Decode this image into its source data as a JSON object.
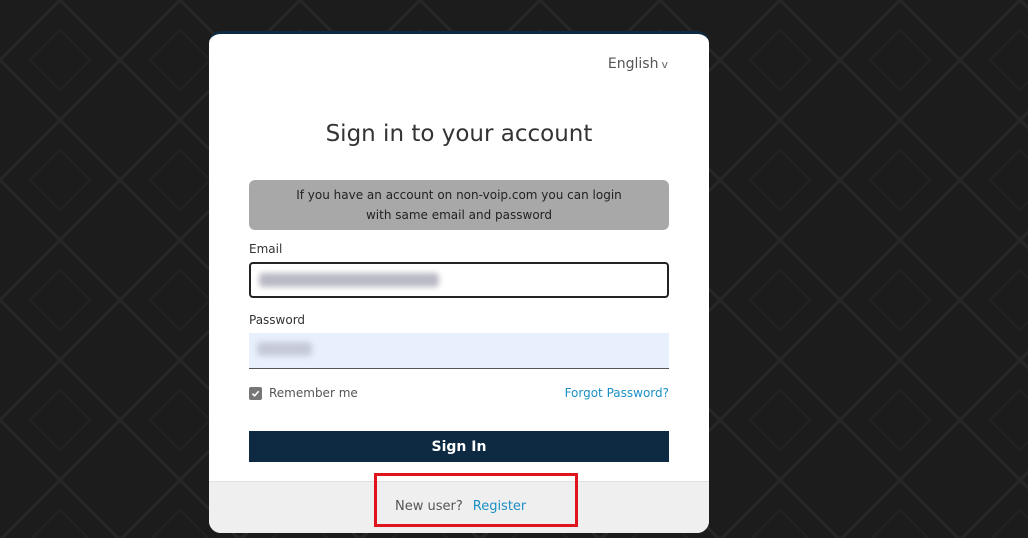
{
  "language": {
    "label": "English",
    "chevron": "v"
  },
  "title": "Sign in to your account",
  "notice": {
    "line1": "If you have an account on non-voip.com you can login",
    "line2": "with same email and password"
  },
  "email": {
    "label": "Email"
  },
  "password": {
    "label": "Password"
  },
  "remember": {
    "label": "Remember me",
    "checked": true
  },
  "forgot_label": "Forgot Password?",
  "signin_label": "Sign In",
  "footer": {
    "new_user": "New user?",
    "register": "Register"
  },
  "colors": {
    "background": "#1c1c1c",
    "primary": "#0d2a42",
    "link": "#1b8fc6",
    "notice_bg": "#a8a8a8",
    "highlight": "#e0141d"
  }
}
